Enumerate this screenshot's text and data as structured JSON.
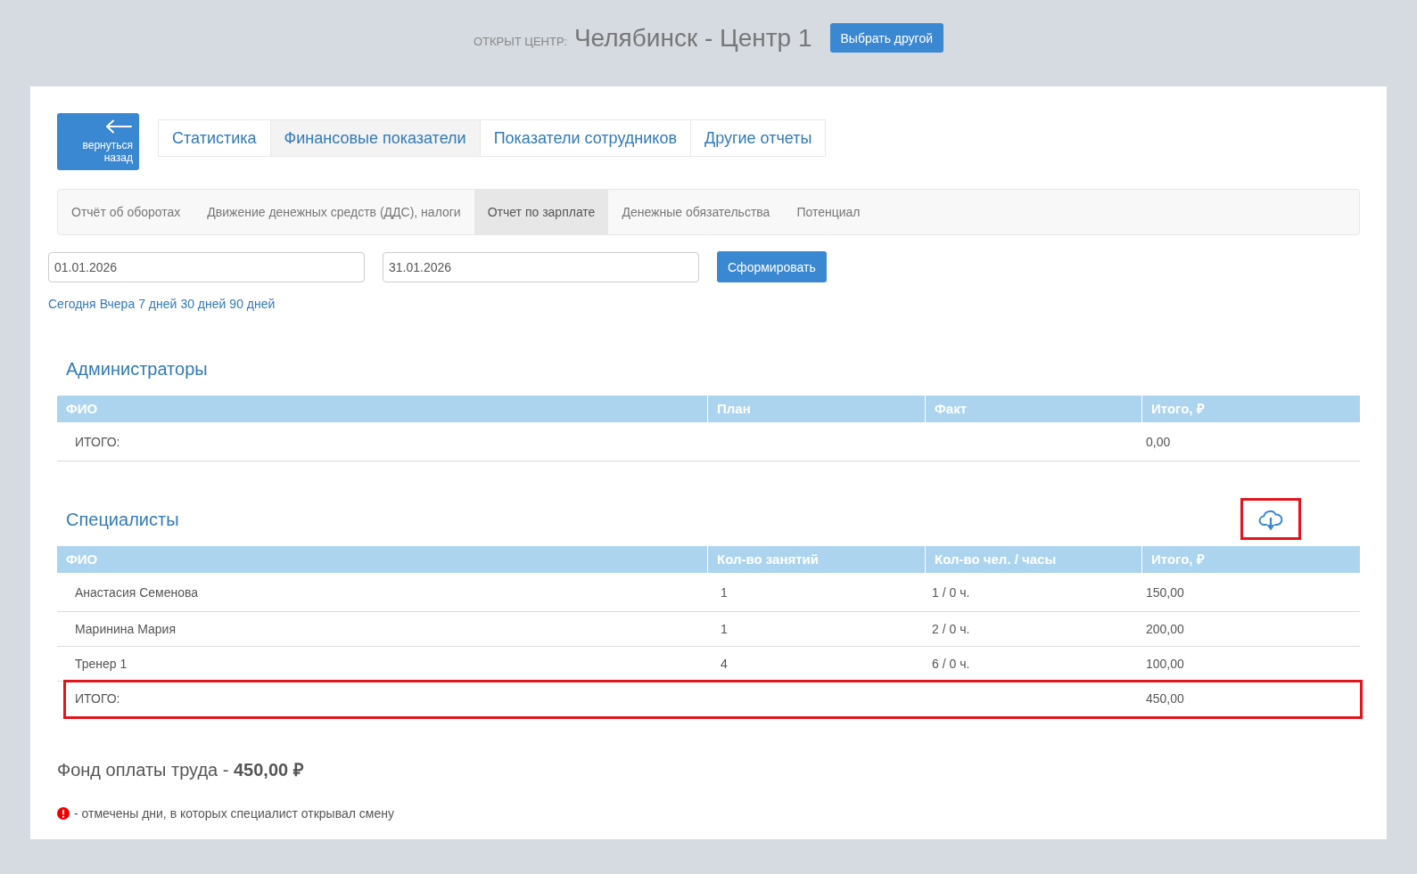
{
  "header": {
    "caption": "ОТКРЫТ ЦЕНТР:",
    "center_name": "Челябинск - Центр 1",
    "change_button": "Выбрать другой"
  },
  "back_button": "вернуться назад",
  "main_tabs": [
    {
      "label": "Статистика",
      "selected": false
    },
    {
      "label": "Финансовые показатели",
      "selected": true
    },
    {
      "label": "Показатели сотрудников",
      "selected": false
    },
    {
      "label": "Другие отчеты",
      "selected": false
    }
  ],
  "sub_tabs": [
    {
      "label": "Отчёт об оборотах",
      "selected": false
    },
    {
      "label": "Движение денежных средств (ДДС), налоги",
      "selected": false
    },
    {
      "label": "Отчет по зарплате",
      "selected": true
    },
    {
      "label": "Денежные обязательства",
      "selected": false
    },
    {
      "label": "Потенциал",
      "selected": false
    }
  ],
  "filters": {
    "date_from": "01.01.2026",
    "date_to": "31.01.2026",
    "submit_button": "Сформировать",
    "quick_ranges": [
      "Сегодня",
      "Вчера",
      "7 дней",
      "30 дней",
      "90 дней"
    ]
  },
  "sections": [
    {
      "title": "Администраторы",
      "table": {
        "columns": [
          "ФИО",
          "План",
          "Факт",
          "Итого, ₽"
        ],
        "rows": [
          {
            "kind": "total",
            "label": "ИТОГО:",
            "value": "0,00",
            "highlighted": false
          }
        ]
      }
    },
    {
      "title": "Специалисты",
      "download_button": {
        "highlighted": true
      },
      "table": {
        "columns": [
          "ФИО",
          "Кол-во занятий",
          "Кол-во чел. / часы",
          "Итого, ₽"
        ],
        "rows": [
          {
            "kind": "person",
            "cells": [
              "Анастасия Семенова",
              "1",
              "1 / 0 ч.",
              "150,00"
            ],
            "highlighted": false
          },
          {
            "kind": "person",
            "cells": [
              "Маринина Мария",
              "1",
              "2 / 0 ч.",
              "200,00"
            ],
            "highlighted": false
          },
          {
            "kind": "person",
            "cells": [
              "Тренер 1",
              "4",
              "6 / 0 ч.",
              "100,00"
            ],
            "highlighted": false
          },
          {
            "kind": "total",
            "label": "ИТОГО:",
            "value": "450,00",
            "highlighted": true
          }
        ]
      }
    }
  ],
  "payroll_fund": "Фонд оплаты труда - **450,00 ₽**",
  "legend": "- отмечены дни, в которых специалист открывал смену"
}
